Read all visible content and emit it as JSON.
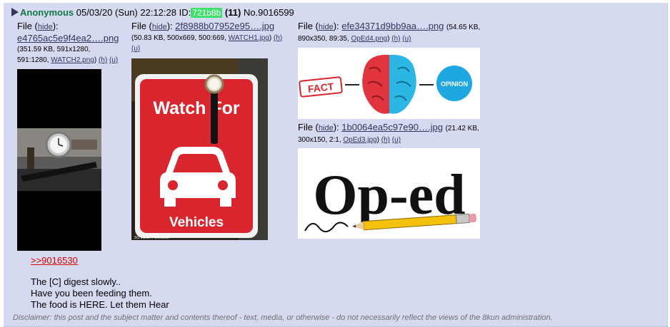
{
  "post": {
    "name": "Anonymous",
    "date": "05/03/20 (Sun) 22:12:28",
    "id_label": "ID:",
    "poster_id": "721b8b",
    "reply_count": "(11)",
    "number": "No.9016599"
  },
  "files": [
    {
      "prefix": "File (",
      "hide": "hide",
      "mid": "):",
      "name": "e4765ac5e9f4ea2….png",
      "meta": "(351.59 KB, 591x1280,",
      "meta2": "591:1280,",
      "orig": "WATCH2.png",
      "h": "(h)",
      "u": "(u)"
    },
    {
      "prefix": "File (",
      "hide": "hide",
      "mid": "):",
      "name": "2f8988b07952e95….jpg",
      "meta": "(50.83 KB, 500x669, 500:669,",
      "orig": "WATCH1.jpg",
      "close": ")",
      "h": "(h)",
      "u": "(u)",
      "sign_text": {
        "line1": "Watch For",
        "line2": "Vehicles",
        "credit": "SO MUCH PUN.COM"
      }
    },
    {
      "prefix": "File (",
      "hide": "hide",
      "mid": "):",
      "name": "efe34371d9bb9aa….png",
      "meta": "(54.65 KB,",
      "meta2": "890x350, 89:35,",
      "orig": "OpEd4.png",
      "close": ")",
      "h": "(h)",
      "u": "(u)",
      "art_text": {
        "fact": "FACT",
        "opinion": "OPINION"
      }
    },
    {
      "prefix": "File (",
      "hide": "hide",
      "mid": "):",
      "name": "1b0064ea5c97e90….jpg",
      "meta": "(21.42 KB,",
      "meta2": "300x150, 2:1,",
      "orig": "OpEd3.jpg",
      "close": ")",
      "h": "(h)",
      "u": "(u)",
      "art_text": {
        "oped": "Op-ed"
      }
    }
  ],
  "body": {
    "backlink": ">>9016530",
    "lines": [
      "The [C] digest slowly..",
      "Have you been feeding them.",
      "The food is HERE. Let them Hear"
    ]
  },
  "disclaimer": "Disclaimer: this post and the subject matter and contents thereof - text, media, or otherwise - do not necessarily reflect the views of the 8kun administration.",
  "colors": {
    "post_bg": "#d6daf0",
    "name": "#117743",
    "poster_id_bg": "#3ee06a",
    "link": "#34345c",
    "backlink": "#dd0000",
    "sign_red": "#d8252e"
  }
}
